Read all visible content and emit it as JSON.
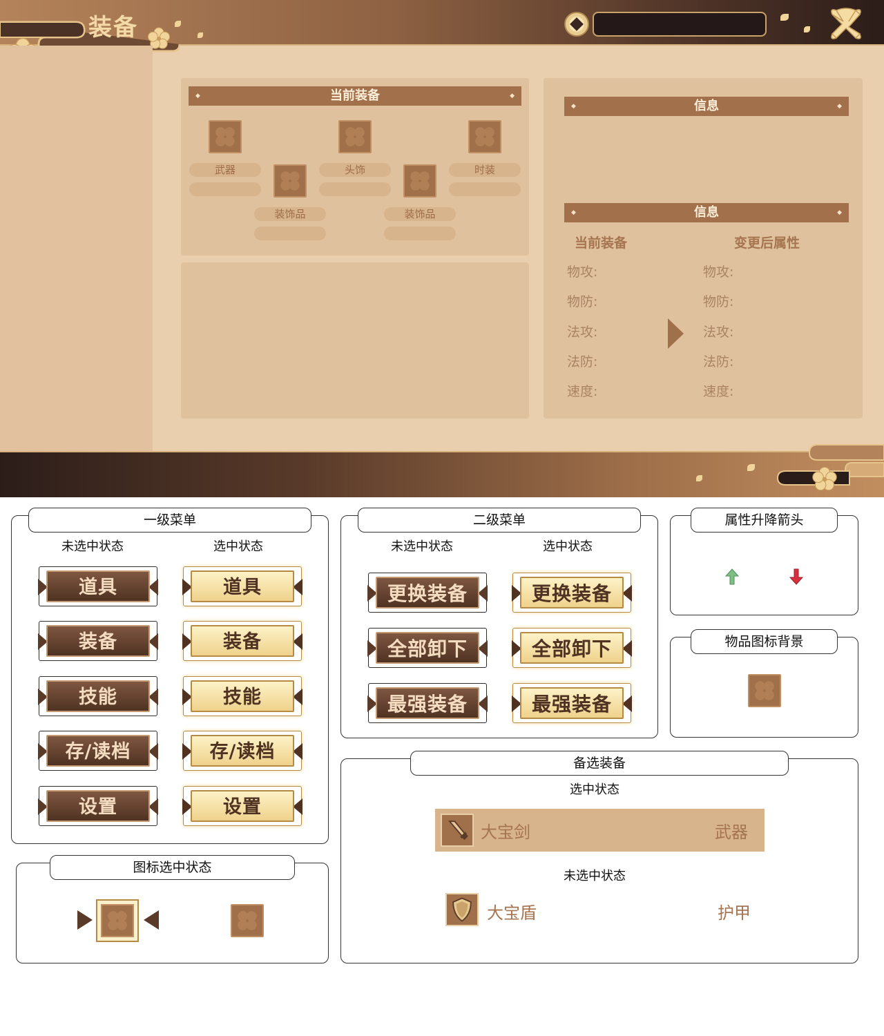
{
  "game": {
    "title": "装备",
    "equip_panel": {
      "banner": "当前装备",
      "slots": [
        {
          "label": "武器"
        },
        {
          "label": "头饰"
        },
        {
          "label": "时装"
        },
        {
          "label": "装饰品"
        },
        {
          "label": "装饰品"
        }
      ]
    },
    "info_panel": {
      "banner_top": "信息",
      "banner_bottom": "信息",
      "col_current": "当前装备",
      "col_after": "变更后属性",
      "stats": [
        "物攻:",
        "物防:",
        "法攻:",
        "法防:",
        "速度:"
      ]
    }
  },
  "sheet": {
    "menu1": {
      "title": "一级菜单",
      "off_caption": "未选中状态",
      "on_caption": "选中状态",
      "items": [
        "道具",
        "装备",
        "技能",
        "存/读档",
        "设置"
      ]
    },
    "menu2": {
      "title": "二级菜单",
      "off_caption": "未选中状态",
      "on_caption": "选中状态",
      "items": [
        "更换装备",
        "全部卸下",
        "最强装备"
      ]
    },
    "arrows": {
      "title": "属性升降箭头",
      "up_color": "#7fbf86",
      "down_color": "#d8303f"
    },
    "item_bg": {
      "title": "物品图标背景"
    },
    "icon_select": {
      "title": "图标选中状态"
    },
    "alt_equip": {
      "title": "备选装备",
      "selected_caption": "选中状态",
      "selected_item": {
        "name": "大宝剑",
        "type": "武器",
        "icon": "sword-icon"
      },
      "unselected_caption": "未选中状态",
      "unselected_item": {
        "name": "大宝盾",
        "type": "护甲",
        "icon": "shield-icon"
      }
    }
  },
  "colors": {
    "accent": "#a2704b",
    "panel": "#e0c19d",
    "gold": "#efd28c"
  }
}
